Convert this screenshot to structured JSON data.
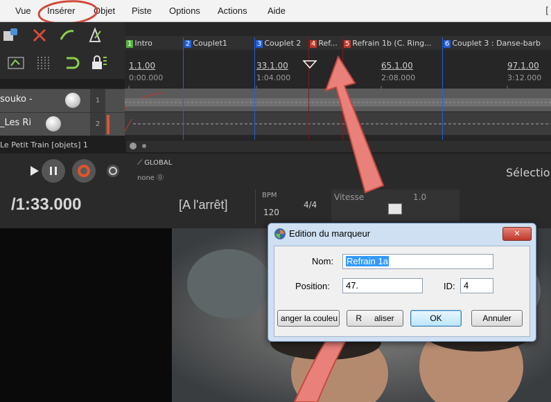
{
  "menu": {
    "items": [
      {
        "label": "Vue"
      },
      {
        "label": "Insérer"
      },
      {
        "label": "Objet"
      },
      {
        "label": "Piste"
      },
      {
        "label": "Options"
      },
      {
        "label": "Actions"
      },
      {
        "label": "Aide"
      }
    ],
    "bracket": "["
  },
  "markers": [
    {
      "id": "1",
      "name": "Intro",
      "color": "#55b33f"
    },
    {
      "id": "2",
      "name": "Couplet1",
      "color": "#2060e0"
    },
    {
      "id": "3",
      "name": "Couplet 2",
      "color": "#2060e0"
    },
    {
      "id": "4",
      "name": "Ref...",
      "color": "#c0392b"
    },
    {
      "id": "5",
      "name": "Refrain 1b (C. Ring...",
      "color": "#c0392b"
    },
    {
      "id": "6",
      "name": "Couplet 3 : Danse-barb",
      "color": "#2060e0"
    }
  ],
  "ruler": [
    {
      "bar": "1.1.00",
      "time": "0:00.000"
    },
    {
      "bar": "33.1.00",
      "time": "1:04.000"
    },
    {
      "bar": "65.1.00",
      "time": "2:08.000"
    },
    {
      "bar": "97.1.00",
      "time": "3:12.000"
    }
  ],
  "tracks": [
    {
      "name": "souko -",
      "num": "1"
    },
    {
      "name": "_Les Ri",
      "num": "2"
    }
  ],
  "item_label": "Le Petit Train [objets] 1",
  "transport": {
    "global_label": "GLOBAL",
    "none_label": "none",
    "selection_label": "Sélectio",
    "position": "/1:33.000",
    "state": "[A l'arrêt]",
    "bpm_label": "BPM",
    "bpm_value": "120",
    "time_sig": "4/4",
    "rate_label": "Vitesse",
    "rate_value": "1.0"
  },
  "dialog": {
    "title": "Edition du marqueur",
    "name_label": "Nom:",
    "name_value": "Refrain 1a",
    "position_label": "Position:",
    "position_value": "47.",
    "id_label": "ID:",
    "id_value": "4",
    "btn_color": "anger la couleu",
    "btn_reset": "R",
    "btn_reset_tail": "aliser",
    "btn_ok": "OK",
    "btn_cancel": "Annuler",
    "close_glyph": "✕"
  },
  "colors": {
    "annotation_red": "#d24a3c",
    "arrow_fill": "#e9807a",
    "marker_red": "#c0392b",
    "marker_blue": "#2060e0",
    "marker_green": "#55b33f",
    "record_orange": "#e0542b"
  }
}
